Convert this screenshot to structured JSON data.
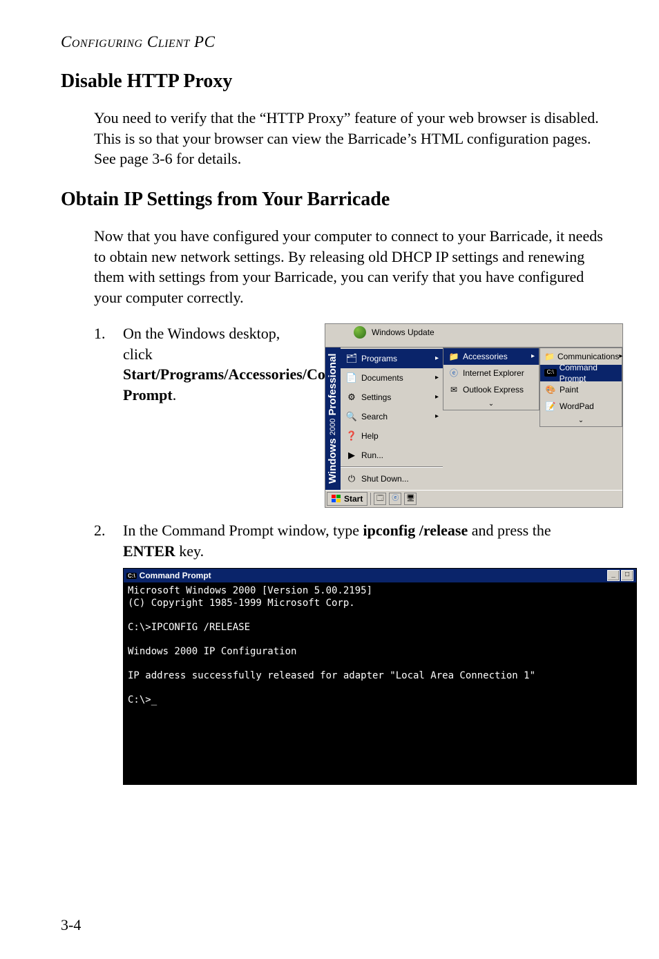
{
  "running_head": "Configuring Client PC",
  "section1_title": "Disable HTTP Proxy",
  "section1_body": "You need to verify that the “HTTP Proxy” feature of your web browser is disabled. This is so that your browser can view the Barricade’s HTML configuration pages. See page 3-6 for details.",
  "section2_title": "Obtain IP Settings from Your Barricade",
  "section2_body": "Now that you have configured your computer to connect to your Barricade, it needs to obtain new network settings. By releasing old DHCP IP settings and renewing them with settings from your Barricade, you can verify that you have configured your computer correctly.",
  "step1_num": "1.",
  "step1_text_pre": "On the Windows desktop, click ",
  "step1_text_bold": "Start/Programs/Accessories/Command Prompt",
  "step1_text_post": ".",
  "step2_num": "2.",
  "step2_text_pre": "In the Command Prompt window, type ",
  "step2_text_bold": "ipconfig /release",
  "step2_text_mid": " and press the ",
  "step2_text_bold2": "ENTER",
  "step2_text_post": " key.",
  "startmenu": {
    "windows_update": "Windows Update",
    "brand_main": "Windows",
    "brand_year": "2000",
    "brand_edition": "Professional",
    "items": [
      {
        "icon": "programs-icon",
        "label": "Programs",
        "arrow": true
      },
      {
        "icon": "documents-icon",
        "label": "Documents",
        "arrow": true
      },
      {
        "icon": "settings-icon",
        "label": "Settings",
        "arrow": true
      },
      {
        "icon": "search-icon",
        "label": "Search",
        "arrow": true
      },
      {
        "icon": "help-icon",
        "label": "Help",
        "arrow": false
      },
      {
        "icon": "run-icon",
        "label": "Run...",
        "arrow": false
      },
      {
        "sep": true
      },
      {
        "icon": "shutdown-icon",
        "label": "Shut Down...",
        "arrow": false
      }
    ],
    "submenu1": [
      {
        "label": "Accessories",
        "highlight": true,
        "arrow": true
      },
      {
        "label": "Internet Explorer",
        "highlight": false,
        "arrow": false
      },
      {
        "label": "Outlook Express",
        "highlight": false,
        "arrow": false
      }
    ],
    "submenu2": [
      {
        "label": "Communications",
        "highlight": false,
        "arrow": true
      },
      {
        "label": "Command Prompt",
        "highlight": true,
        "arrow": false
      },
      {
        "label": "Paint",
        "highlight": false,
        "arrow": false
      },
      {
        "label": "WordPad",
        "highlight": false,
        "arrow": false
      }
    ],
    "taskbar_start": "Start"
  },
  "cmd": {
    "title": "Command Prompt",
    "line1": "Microsoft Windows 2000 [Version 5.00.2195]",
    "line2": "(C) Copyright 1985-1999 Microsoft Corp.",
    "line3": "C:\\>IPCONFIG /RELEASE",
    "line4": "Windows 2000 IP Configuration",
    "line5": "IP address successfully released for adapter \"Local Area Connection 1\"",
    "line6": "C:\\>"
  },
  "page_number": "3-4"
}
